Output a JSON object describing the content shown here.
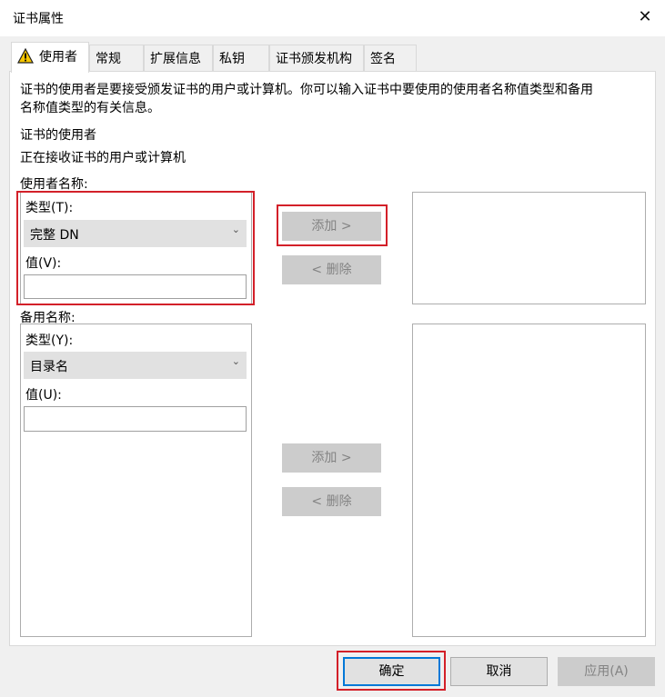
{
  "window": {
    "title": "证书属性",
    "close_glyph": "✕"
  },
  "tabs": [
    {
      "label": "使用者",
      "icon": "warning-icon",
      "active": true
    },
    {
      "label": "常规"
    },
    {
      "label": "扩展信息"
    },
    {
      "label": "私钥"
    },
    {
      "label": "证书颁发机构"
    },
    {
      "label": "签名"
    }
  ],
  "subject": {
    "description_line1": "证书的使用者是要接受颁发证书的用户或计算机。你可以输入证书中要使用的使用者名称值类型和备用",
    "description_line2": "名称值类型的有关信息。",
    "section_title": "证书的使用者",
    "section_desc": "正在接收证书的用户或计算机",
    "subject_name": {
      "label": "使用者名称:",
      "type_label": "类型(T):",
      "type_value": "完整 DN",
      "value_label": "值(V):",
      "value": ""
    },
    "alt_name": {
      "label": "备用名称:",
      "type_label": "类型(Y):",
      "type_value": "目录名",
      "value_label": "值(U):",
      "value": ""
    },
    "add_label": "添加 >",
    "remove_label": "< 删除"
  },
  "footer": {
    "ok": "确定",
    "cancel": "取消",
    "apply": "应用(A)"
  },
  "colors": {
    "highlight": "#d32029",
    "focus": "#0078d7",
    "disabled_bg": "#cccccc"
  }
}
